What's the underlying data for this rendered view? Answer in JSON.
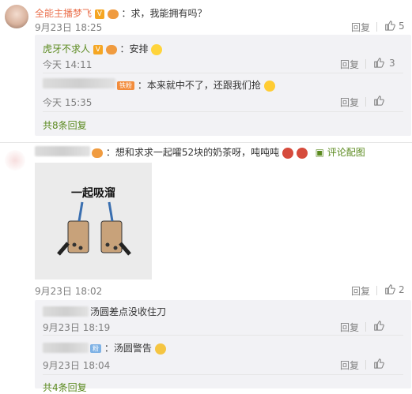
{
  "comments": [
    {
      "author": "全能主播梦飞",
      "text": "：求，我能拥有吗？",
      "time": "9月23日 18:25",
      "reply_label": "回复",
      "likes": "5",
      "replies": [
        {
          "author": "虎牙不求人",
          "text": "：安排",
          "time": "今天 14:11",
          "reply_label": "回复",
          "likes": "3"
        },
        {
          "author_badge": "铁粉",
          "text": "：本来就中不了，还跟我们抢",
          "time": "今天 15:35",
          "reply_label": "回复",
          "likes": ""
        }
      ],
      "more_replies": "共8条回复"
    },
    {
      "text": "：想和求求一起嚯52块的奶茶呀，吨吨吨",
      "comment_image_link": "评论配图",
      "image_caption": "一起吸溜",
      "time": "9月23日 18:02",
      "reply_label": "回复",
      "likes": "2",
      "replies": [
        {
          "text": "汤圆差点没收住刀",
          "time": "9月23日 18:19",
          "reply_label": "回复",
          "likes": ""
        },
        {
          "author_badge": "粉",
          "text": "：汤圆警告",
          "time": "9月23日 18:04",
          "reply_label": "回复",
          "likes": ""
        }
      ],
      "more_replies": "共4条回复"
    }
  ],
  "colors": {
    "name": "#eb7350",
    "link": "#5b8a1f",
    "muted": "#808080",
    "box": "#f2f2f5"
  },
  "icons": [
    "thumbs-up-icon",
    "vip-badge-icon",
    "level-badge-icon",
    "image-icon"
  ]
}
